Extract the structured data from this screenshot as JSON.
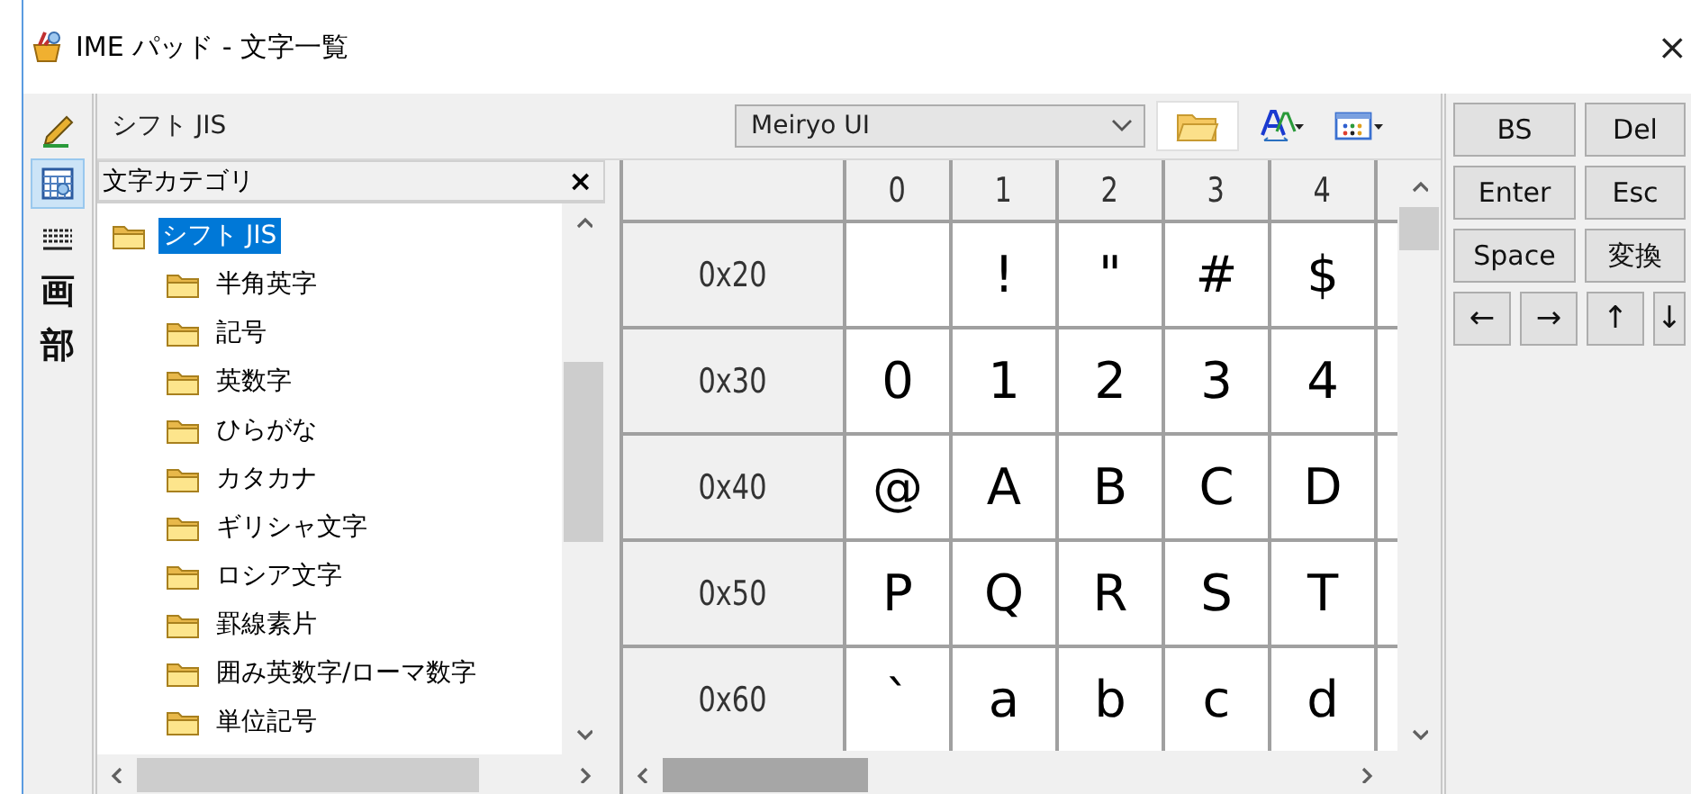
{
  "window": {
    "title": "IME パッド - 文字一覧",
    "close": "×"
  },
  "tool_strip": [
    {
      "kind": "pen",
      "selected": false
    },
    {
      "kind": "grid",
      "selected": true
    },
    {
      "kind": "keyboard",
      "selected": false
    },
    {
      "kind": "glyph",
      "label": "画",
      "selected": false
    },
    {
      "kind": "glyph",
      "label": "部",
      "selected": false
    }
  ],
  "toolbar": {
    "charset": "シフト JIS",
    "font": "Meiryo UI",
    "buttons": [
      {
        "kind": "folder"
      },
      {
        "kind": "font-size"
      },
      {
        "kind": "view"
      }
    ]
  },
  "category": {
    "title": "文字カテゴリ",
    "close": "×",
    "tree": [
      {
        "label": "シフト JIS",
        "selected": true,
        "expanded": true,
        "children": [
          {
            "label": "半角英字",
            "selected": false
          },
          {
            "label": "記号",
            "selected": false
          },
          {
            "label": "英数字",
            "selected": false
          },
          {
            "label": "ひらがな",
            "selected": false
          },
          {
            "label": "カタカナ",
            "selected": false
          },
          {
            "label": "ギリシャ文字",
            "selected": false
          },
          {
            "label": "ロシア文字",
            "selected": false
          },
          {
            "label": "罫線素片",
            "selected": false
          },
          {
            "label": "囲み英数字/ローマ数字",
            "selected": false
          },
          {
            "label": "単位記号",
            "selected": false
          }
        ]
      }
    ]
  },
  "grid": {
    "columns": [
      "0",
      "1",
      "2",
      "3",
      "4"
    ],
    "rows": [
      {
        "header": "0x20",
        "cells": [
          " ",
          "!",
          "\"",
          "#",
          "$"
        ]
      },
      {
        "header": "0x30",
        "cells": [
          "0",
          "1",
          "2",
          "3",
          "4"
        ]
      },
      {
        "header": "0x40",
        "cells": [
          "@",
          "A",
          "B",
          "C",
          "D"
        ]
      },
      {
        "header": "0x50",
        "cells": [
          "P",
          "Q",
          "R",
          "S",
          "T"
        ]
      },
      {
        "header": "0x60",
        "cells": [
          "`",
          "a",
          "b",
          "c",
          "d"
        ]
      }
    ]
  },
  "keypad": {
    "keys": [
      {
        "label": "BS",
        "kind": "wide"
      },
      {
        "label": "Del",
        "kind": "wide"
      },
      {
        "label": "Enter",
        "kind": "wide"
      },
      {
        "label": "Esc",
        "kind": "wide"
      },
      {
        "label": "Space",
        "kind": "wide"
      },
      {
        "label": "変換",
        "kind": "wide"
      },
      {
        "label": "←",
        "kind": "arrow"
      },
      {
        "label": "→",
        "kind": "arrow"
      },
      {
        "label": "↑",
        "kind": "arrow"
      },
      {
        "label": "↓",
        "kind": "arrow"
      }
    ]
  }
}
